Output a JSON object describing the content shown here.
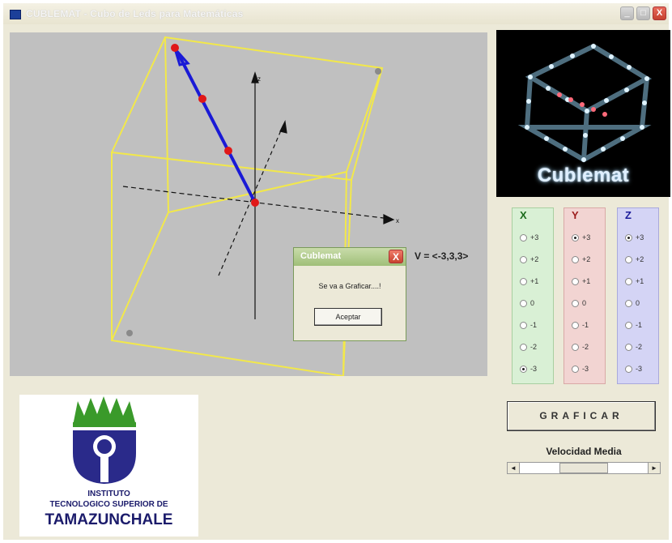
{
  "window": {
    "title": "CUBLEMAT - Cubo de Leds para Matemáticas",
    "buttons": {
      "minimize": "_",
      "maximize": "□",
      "close": "X"
    }
  },
  "graph": {
    "axis_labels": {
      "z": "z",
      "x": "x"
    }
  },
  "vector_label": "V = <-3,3,3>",
  "dialog": {
    "title": "Cublemat",
    "message": "Se va a Graficar....!",
    "ok_label": "Aceptar",
    "close_label": "X"
  },
  "logo": {
    "text": "Cublemat"
  },
  "axes": [
    {
      "name": "X",
      "options": [
        "+3",
        "+2",
        "+1",
        "0",
        "-1",
        "-2",
        "-3"
      ],
      "selected": "-3",
      "color": "#1c6b1c"
    },
    {
      "name": "Y",
      "options": [
        "+3",
        "+2",
        "+1",
        "0",
        "-1",
        "-2",
        "-3"
      ],
      "selected": "+3",
      "color": "#9b1c1c"
    },
    {
      "name": "Z",
      "options": [
        "+3",
        "+2",
        "+1",
        "0",
        "-1",
        "-2",
        "-3"
      ],
      "selected": "+3",
      "color": "#1c1c9b"
    }
  ],
  "graficar_label": "GRAFICAR",
  "speed": {
    "label": "Velocidad Media",
    "left_arrow": "◄",
    "right_arrow": "►",
    "thumb_fraction": 0.5
  },
  "institution": {
    "line1": "INSTITUTO",
    "line2": "TECNOLOGICO SUPERIOR DE",
    "line3": "TAMAZUNCHALE"
  },
  "colors": {
    "cube": "#f2e84a",
    "vector": "#1a1ad6",
    "led_on": "#e01818",
    "led_off": "#8a8a8a",
    "graph_bg": "#c0c0c0"
  }
}
